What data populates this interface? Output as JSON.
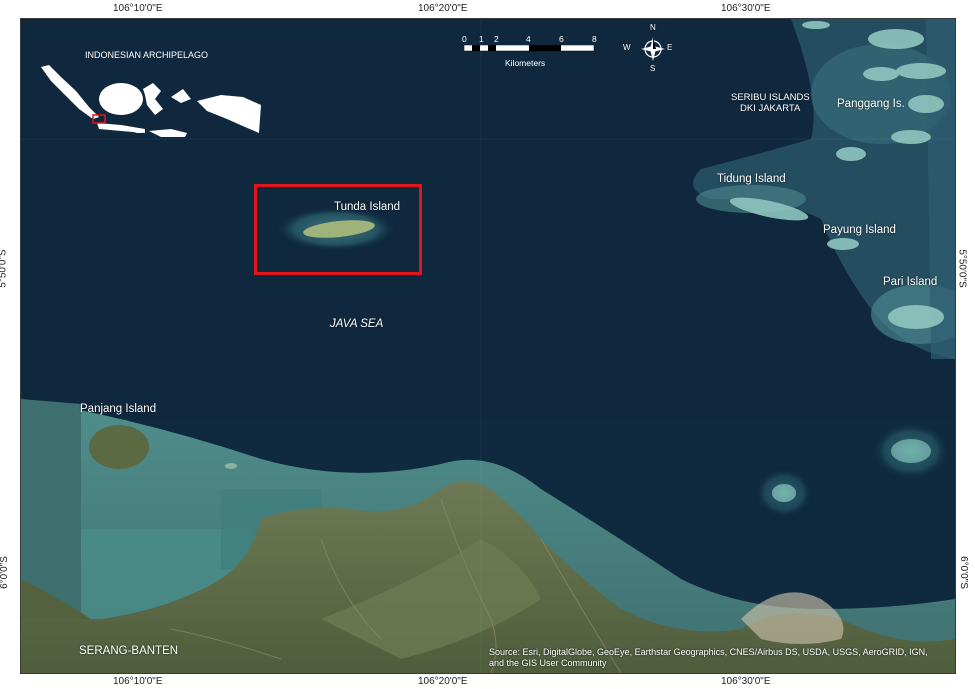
{
  "top_coords": [
    "106°10'0\"E",
    "106°20'0\"E",
    "106°30'0\"E"
  ],
  "bottom_coords": [
    "106°10'0\"E",
    "106°20'0\"E",
    "106°30'0\"E"
  ],
  "left_coords": [
    "5°50'0\"S",
    "6°0'0\"S"
  ],
  "right_coords": [
    "5°50'0\"S",
    "6°0'0\"S"
  ],
  "inset": {
    "title": "INDONESIAN ARCHIPELAGO"
  },
  "scale": {
    "ticks": [
      "0",
      "1",
      "2",
      "4",
      "6",
      "8"
    ],
    "unit": "Kilometers"
  },
  "north_arrow": {
    "n": "N",
    "s": "S",
    "e": "E",
    "w": "W",
    "icon": "compass-rose-icon"
  },
  "labels": {
    "seribu": "SERIBU ISLANDS",
    "dki": "DKI JAKARTA",
    "panggang": "Panggang Is.",
    "tidung": "Tidung Island",
    "payung": "Payung Island",
    "pari": "Pari Island",
    "tunda": "Tunda Island",
    "java_sea": "JAVA SEA",
    "panjang": "Panjang Island",
    "serang": "SERANG-BANTEN"
  },
  "source": {
    "line1": "Source: Esri, DigitalGlobe, GeoEye, Earthstar Geographics, CNES/Airbus DS, USDA, USGS, AeroGRID, IGN,",
    "line2": "and the GIS User Community"
  },
  "colors": {
    "sea": "#0f2a3f",
    "highlight": "#e0161a",
    "land": "#5d6e4a",
    "shallow": "#4a8a88"
  }
}
